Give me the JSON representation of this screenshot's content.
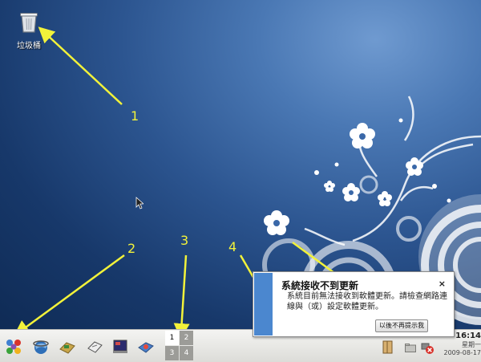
{
  "desktop": {
    "icons": [
      {
        "label": "垃圾桶",
        "icon": "trash-icon"
      }
    ]
  },
  "annotations": [
    "1",
    "2",
    "3",
    "4"
  ],
  "panel": {
    "launchers": [
      {
        "icon": "main-menu-icon"
      },
      {
        "icon": "web-browser-icon"
      },
      {
        "icon": "file-manager-icon"
      },
      {
        "icon": "text-editor-icon"
      },
      {
        "icon": "terminal-icon"
      },
      {
        "icon": "update-icon"
      }
    ],
    "workspaces": [
      "1",
      "2",
      "3",
      "4"
    ],
    "active_workspace": "1",
    "tray": {
      "icons": [
        "book-icon",
        "folder-icon",
        "network-error-icon"
      ]
    },
    "clock": {
      "time": "16:14",
      "day": "星期一",
      "date": "2009-08-17"
    }
  },
  "notification": {
    "title": "系統接收不到更新",
    "close": "×",
    "body": "系統目前無法接收到軟體更新。請檢查網路連線與（或）設定軟體更新。",
    "button": "以後不再提示我"
  },
  "colors": {
    "annotation": "#f2f23a",
    "desktop_top": "#6f9ad0",
    "desktop_bottom": "#0f2b55",
    "notification_stripe": "#4b87cf"
  }
}
